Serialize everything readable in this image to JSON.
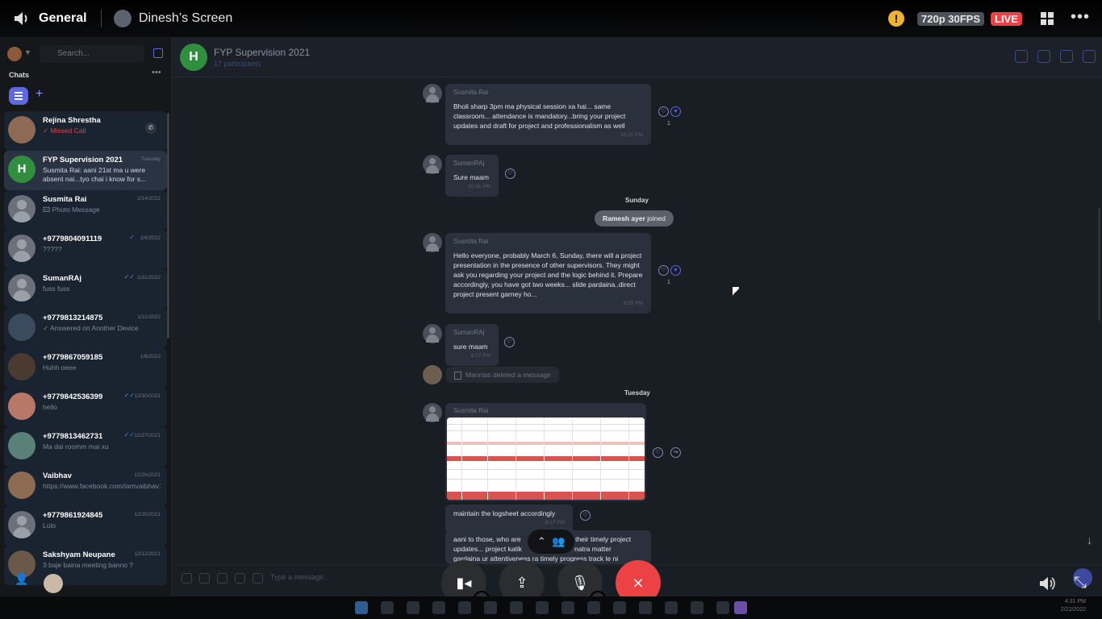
{
  "discord": {
    "channel": "General",
    "screen_name": "Dinesh’s Screen",
    "warning": "!",
    "quality": "720p 30FPS",
    "live": "LIVE"
  },
  "sidebar": {
    "search_placeholder": "Search...",
    "chats_label": "Chats",
    "more": "•••",
    "items": [
      {
        "name": "Rejina Shrestha",
        "preview": "✓ Missed Call",
        "date": "",
        "type": "missed"
      },
      {
        "name": "FYP Supervision 2021",
        "preview": "Susmita Rai: aani 21st ma u were absent nai...tyo chai i know for s...",
        "date": "Tuesday",
        "type": "selected"
      },
      {
        "name": "Susmita Rai",
        "preview": "🖾 Photo Message",
        "date": "2/14/2022",
        "type": ""
      },
      {
        "name": "+9779804091119",
        "preview": "?????",
        "date": "2/6/2022",
        "type": ""
      },
      {
        "name": "SumanRAj",
        "preview": "fuss fuss",
        "date": "1/31/2022",
        "type": ""
      },
      {
        "name": "+9779813214875",
        "preview": "✓ Answered on Another Device",
        "date": "1/11/2022",
        "type": ""
      },
      {
        "name": "+9779867059185",
        "preview": "Huhh oeee",
        "date": "1/8/2022",
        "type": ""
      },
      {
        "name": "+9779842536399",
        "preview": "hello",
        "date": "12/30/2021",
        "type": ""
      },
      {
        "name": "+9779813462731",
        "preview": "Ma dai roomm mai xu",
        "date": "12/27/2021",
        "type": ""
      },
      {
        "name": "Vaibhav",
        "preview": "https://www.facebook.com/iamvaibhav10",
        "date": "12/26/2021",
        "type": ""
      },
      {
        "name": "+9779861924845",
        "preview": "Lolo",
        "date": "12/20/2021",
        "type": ""
      },
      {
        "name": "Sakshyam Neupane",
        "preview": "3 baje baina meeting banno ?",
        "date": "12/12/2021",
        "type": ""
      }
    ]
  },
  "chat": {
    "group_name": "FYP Supervision 2021",
    "participants": "17 participants",
    "composer_placeholder": "Type a message...",
    "messages": {
      "m1_sender": "Susmita Rai",
      "m1_text": "Bholi sharp 3pm ma physical session xa hai... same classroom... attendance is mandatory...bring your project updates and draft for project and professionalism as well",
      "m1_time": "10:21 PM",
      "m1_react": "1",
      "m2_sender": "SumanRAj",
      "m2_text": "Sure maam",
      "m2_time": "10:31 PM",
      "day1": "Sunday",
      "join_name": "Ramesh ayer",
      "join_text": "joined",
      "m3_sender": "Susmita Rai",
      "m3_text": "Hello everyone, probably March 6, Sunday, there will a project presentation in the presence of other supervisors. They might ask you regarding your project and the logic behind it. Prepare accordingly, you have got two weeks... slide pardaina..direct project present garney ho...",
      "m3_time": "9:25 PM",
      "m3_react": "1",
      "m4_sender": "SumanRAj",
      "m4_text": "sure maam",
      "m4_time": "9:27 PM",
      "deleted": "Manniss deleted a message",
      "day2": "Tuesday",
      "m5_sender": "Susmita Rai",
      "m5_time": "8:16 PM",
      "m6_text": "maintain the logsheet accordingly",
      "m6_time": "8:17 PM",
      "m7_text_a": "aani to those, who are",
      "m7_text_b": "g their timely project",
      "m7_text_c": "updates... project katik",
      "m7_text_d": "natra matter",
      "m7_text_e": "gardaina ur attentiveness ra timely progress track le ni"
    }
  },
  "taskbar": {
    "time": "4:31 PM",
    "date": "2/22/2022"
  }
}
